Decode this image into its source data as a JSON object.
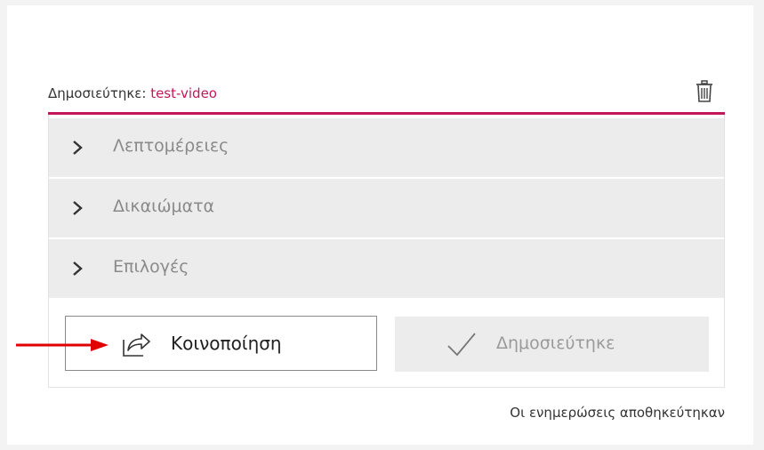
{
  "header": {
    "prefix": "Δημοσιεύτηκε:",
    "video_name": "test-video",
    "delete_icon": "trash-icon"
  },
  "accordion": [
    {
      "label": "Λεπτομέρειες",
      "icon": "chevron-right-icon"
    },
    {
      "label": "Δικαιώματα",
      "icon": "chevron-right-icon"
    },
    {
      "label": "Επιλογές",
      "icon": "chevron-right-icon"
    }
  ],
  "actions": {
    "share_label": "Κοινοποίηση",
    "share_icon": "share-icon",
    "published_label": "Δημοσιεύτηκε",
    "published_icon": "checkmark-icon"
  },
  "status": "Οι ενημερώσεις αποθηκεύτηκαν",
  "colors": {
    "accent": "#c2185b",
    "annotation_arrow": "#e00000"
  }
}
